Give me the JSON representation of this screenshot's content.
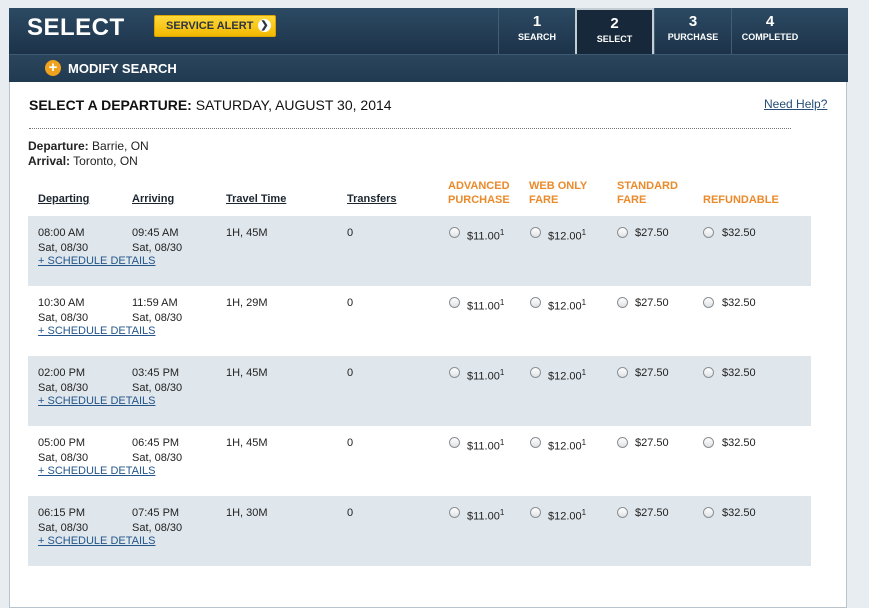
{
  "header": {
    "title": "SELECT",
    "service_alert": "SERVICE ALERT",
    "modify_search": "MODIFY SEARCH",
    "steps": [
      {
        "num": "1",
        "label": "SEARCH"
      },
      {
        "num": "2",
        "label": "SELECT"
      },
      {
        "num": "3",
        "label": "PURCHASE"
      },
      {
        "num": "4",
        "label": "COMPLETED"
      }
    ]
  },
  "main": {
    "heading_label": "SELECT A DEPARTURE:",
    "heading_date": "SATURDAY, AUGUST 30, 2014",
    "help_link": "Need Help?",
    "departure_label": "Departure:",
    "departure_value": "Barrie, ON",
    "arrival_label": "Arrival:",
    "arrival_value": "Toronto, ON"
  },
  "columns": {
    "departing": "Departing",
    "arriving": "Arriving",
    "travel_time": "Travel Time",
    "transfers": "Transfers",
    "advanced_1": "ADVANCED",
    "advanced_2": "PURCHASE",
    "webonly_1": "WEB ONLY",
    "webonly_2": "FARE",
    "standard_1": "STANDARD",
    "standard_2": "FARE",
    "refundable": "REFUNDABLE"
  },
  "rows": [
    {
      "dep_time": "08:00 AM",
      "dep_date": "Sat, 08/30",
      "arr_time": "09:45 AM",
      "arr_date": "Sat, 08/30",
      "travel": "1H, 45M",
      "transfers": "0",
      "schedule": "+ SCHEDULE DETAILS",
      "adv": "$11.00",
      "adv_sup": "1",
      "web": "$12.00",
      "web_sup": "1",
      "std": "$27.50",
      "ref": "$32.50"
    },
    {
      "dep_time": "10:30 AM",
      "dep_date": "Sat, 08/30",
      "arr_time": "11:59 AM",
      "arr_date": "Sat, 08/30",
      "travel": "1H, 29M",
      "transfers": "0",
      "schedule": "+ SCHEDULE DETAILS",
      "adv": "$11.00",
      "adv_sup": "1",
      "web": "$12.00",
      "web_sup": "1",
      "std": "$27.50",
      "ref": "$32.50"
    },
    {
      "dep_time": "02:00 PM",
      "dep_date": "Sat, 08/30",
      "arr_time": "03:45 PM",
      "arr_date": "Sat, 08/30",
      "travel": "1H, 45M",
      "transfers": "0",
      "schedule": "+ SCHEDULE DETAILS",
      "adv": "$11.00",
      "adv_sup": "1",
      "web": "$12.00",
      "web_sup": "1",
      "std": "$27.50",
      "ref": "$32.50"
    },
    {
      "dep_time": "05:00 PM",
      "dep_date": "Sat, 08/30",
      "arr_time": "06:45 PM",
      "arr_date": "Sat, 08/30",
      "travel": "1H, 45M",
      "transfers": "0",
      "schedule": "+ SCHEDULE DETAILS",
      "adv": "$11.00",
      "adv_sup": "1",
      "web": "$12.00",
      "web_sup": "1",
      "std": "$27.50",
      "ref": "$32.50"
    },
    {
      "dep_time": "06:15 PM",
      "dep_date": "Sat, 08/30",
      "arr_time": "07:45 PM",
      "arr_date": "Sat, 08/30",
      "travel": "1H, 30M",
      "transfers": "0",
      "schedule": "+ SCHEDULE DETAILS",
      "adv": "$11.00",
      "adv_sup": "1",
      "web": "$12.00",
      "web_sup": "1",
      "std": "$27.50",
      "ref": "$32.50"
    }
  ],
  "colors": {
    "header_bg": "#1c3349",
    "alert_yellow": "#f2b800",
    "fare_header_orange": "#ea8a2b",
    "link_blue": "#23558a",
    "row_shade": "#dfe6ec"
  }
}
